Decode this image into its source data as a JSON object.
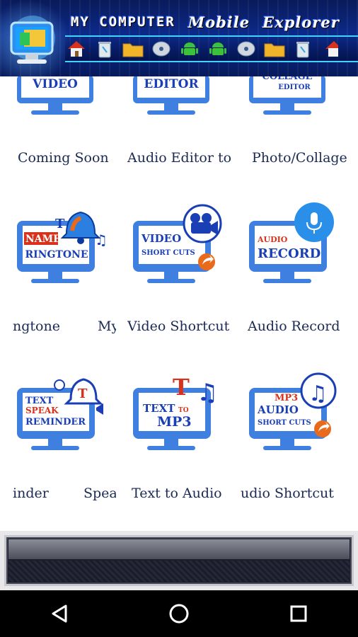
{
  "header": {
    "title_part1": "MY COMPUTER",
    "title_part2": "Mobile",
    "title_part3": "Explorer",
    "toolbar_icons": [
      "home-icon",
      "recycle-bin-icon",
      "folder-icon",
      "disc-icon",
      "android-icon",
      "android-icon",
      "disc-icon",
      "folder-icon",
      "recycle-bin-icon",
      "home-icon"
    ]
  },
  "tiles": [
    {
      "screen_line1": "VIDEO",
      "screen_line2": "",
      "label": "Coming Soon"
    },
    {
      "screen_line1": "EDITOR",
      "screen_line2": "",
      "label": "Audio Editor to"
    },
    {
      "screen_line1": "COLLAGE",
      "screen_line2": "EDITOR",
      "label": "Photo/Collage"
    },
    {
      "screen_line1": "NAME",
      "screen_line2": "RINGTONE",
      "label": "ngtone",
      "label_b": "My"
    },
    {
      "screen_line1": "VIDEO",
      "screen_line2": "SHORT CUTS",
      "label": "Video Shortcut"
    },
    {
      "screen_line1": "AUDIO",
      "screen_line2": "RECORD",
      "label": "Audio Record"
    },
    {
      "screen_line1": "TEXT",
      "screen_line2": "SPEAK",
      "screen_line3": "REMINDER",
      "label": "inder",
      "label_b": "Spea"
    },
    {
      "screen_line1": "TEXT",
      "screen_line2": "MP3",
      "screen_to": "TO",
      "label": "Text to Audio"
    },
    {
      "screen_line1": "MP3",
      "screen_line2": "AUDIO",
      "screen_line3": "SHORT CUTS",
      "label": "udio Shortcut"
    }
  ],
  "colors": {
    "header_bg": "#0c2a8a",
    "accent": "#3fd5ff",
    "monitor_blue": "#3f7fe0",
    "label_text": "#1b2a55"
  },
  "navbar": {
    "back": "back-icon",
    "home": "home-circle-icon",
    "recents": "recents-icon"
  }
}
